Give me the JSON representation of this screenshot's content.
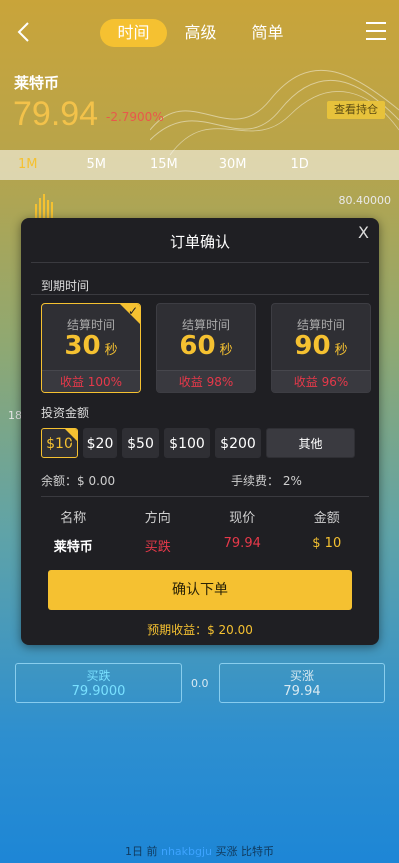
{
  "header": {
    "tabs": [
      "时间",
      "高级",
      "简单"
    ],
    "active_tab": 0
  },
  "asset": {
    "name": "莱特币",
    "price": "79.94",
    "change": "-2.7900%",
    "hold_button": "查看持仓"
  },
  "timeframes": [
    "1M",
    "5M",
    "15M",
    "30M",
    "1D"
  ],
  "chart": {
    "y_top_label": "80.40000",
    "y_mid_label": "18"
  },
  "modal": {
    "title": "订单确认",
    "close": "X",
    "expiry_label": "到期时间",
    "cards": [
      {
        "caption": "结算时间",
        "value": "30",
        "unit": "秒",
        "income": "收益 100%",
        "selected": true
      },
      {
        "caption": "结算时间",
        "value": "60",
        "unit": "秒",
        "income": "收益 98%",
        "selected": false
      },
      {
        "caption": "结算时间",
        "value": "90",
        "unit": "秒",
        "income": "收益 96%",
        "selected": false
      }
    ],
    "amount_label": "投资金额",
    "amounts": [
      "$10",
      "$20",
      "$50",
      "$100",
      "$200",
      "其他"
    ],
    "selected_amount": 0,
    "balance": "余额：$ 0.00",
    "fee": "手续费：  2%",
    "table": {
      "headers": [
        "名称",
        "方向",
        "现价",
        "金额"
      ],
      "row": [
        "莱特币",
        "买跌",
        "79.94",
        "$ 10"
      ]
    },
    "confirm_button": "确认下单",
    "expected": "预期收益：$ 20.00"
  },
  "bottom": {
    "sell_label": "买跌",
    "sell_price": "79.9000",
    "mid_value": "0.0",
    "buy_label": "买涨",
    "buy_price": "79.94"
  },
  "footer": {
    "prefix": "1日 前 ",
    "user": "nhakbgju",
    "suffix": " 买涨 比特币"
  },
  "colors": {
    "accent": "#f5c131",
    "down": "#e6394a",
    "modal_bg": "#1f1f23"
  }
}
